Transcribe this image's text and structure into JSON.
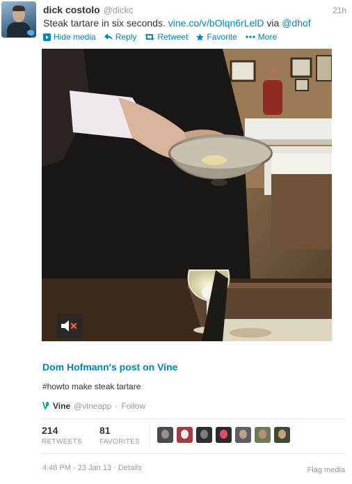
{
  "tweet": {
    "author_name": "dick costolo",
    "author_handle": "@dickc",
    "timestamp": "21h",
    "text_prefix": "Steak tartare in six seconds. ",
    "text_link": "vine.co/v/bOlqn6rLelD",
    "text_middle": " via ",
    "text_mention": "@dhof"
  },
  "actions": {
    "hide_media": "Hide media",
    "reply": "Reply",
    "retweet": "Retweet",
    "favorite": "Favorite",
    "more": "More"
  },
  "media": {
    "mute_icon": "speaker-muted-icon"
  },
  "card": {
    "title": "Dom Hofmann's post on Vine",
    "description": "#howto make steak tartare",
    "site_name": "Vine",
    "site_handle": "@vineapp",
    "separator": "·",
    "follow_label": "Follow"
  },
  "stats": {
    "retweets_count": "214",
    "retweets_label": "RETWEETS",
    "favorites_count": "81",
    "favorites_label": "FAVORITES"
  },
  "faces": [
    {
      "bg": "#4a4a4a",
      "face": "#9b8f86"
    },
    {
      "bg": "#a23b44",
      "face": "#f2f2f2"
    },
    {
      "bg": "#2e2e2e",
      "face": "#7d7d7d"
    },
    {
      "bg": "#2a2a2a",
      "face": "#e24a6a"
    },
    {
      "bg": "#5b6066",
      "face": "#c29f87"
    },
    {
      "bg": "#6d7a5a",
      "face": "#b98f74"
    },
    {
      "bg": "#3e4a33",
      "face": "#c7a07e"
    }
  ],
  "footer": {
    "time": "4:48 PM - 23 Jan 13",
    "separator": "·",
    "details": "Details",
    "flag": "Flag media"
  },
  "colors": {
    "link": "#0084b4",
    "muted_text": "#999999"
  }
}
